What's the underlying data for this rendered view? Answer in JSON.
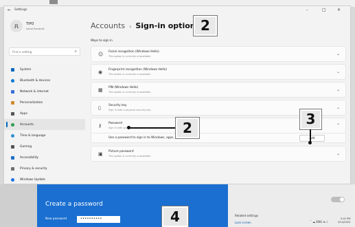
{
  "window": {
    "app_title": "Settings",
    "controls": [
      "–",
      "□",
      "✕"
    ]
  },
  "profile": {
    "initial": "ጸ",
    "name": "TIPO",
    "type": "Local Account"
  },
  "search": {
    "placeholder": "Find a setting"
  },
  "sidebar": {
    "items": [
      {
        "label": "System",
        "color": "#0067c0"
      },
      {
        "label": "Bluetooth & devices",
        "color": "#0078d4"
      },
      {
        "label": "Network & internet",
        "color": "#3a6fd8"
      },
      {
        "label": "Personalization",
        "color": "#d08a30"
      },
      {
        "label": "Apps",
        "color": "#555555"
      },
      {
        "label": "Accounts",
        "color": "#2e9c55",
        "active": true
      },
      {
        "label": "Time & language",
        "color": "#2d8fd0"
      },
      {
        "label": "Gaming",
        "color": "#555555"
      },
      {
        "label": "Accessibility",
        "color": "#1f6fc8"
      },
      {
        "label": "Privacy & security",
        "color": "#707070"
      },
      {
        "label": "Windows Update",
        "color": "#1a73e8"
      }
    ]
  },
  "main": {
    "breadcrumb_parent": "Accounts",
    "breadcrumb_sep": "›",
    "breadcrumb_current": "Sign-in options",
    "ways_label": "Ways to sign in",
    "options": [
      {
        "title": "Facial recognition (Windows Hello)",
        "subtitle": "This option is currently unavailable",
        "icon": "☺",
        "chevron": "⌄"
      },
      {
        "title": "Fingerprint recognition (Windows Hello)",
        "subtitle": "This option is currently unavailable",
        "icon": "◉",
        "chevron": "⌄"
      },
      {
        "title": "PIN (Windows Hello)",
        "subtitle": "This option is currently unavailable",
        "icon": "▦",
        "chevron": "⌄"
      },
      {
        "title": "Security key",
        "subtitle": "Sign in with a physical security key",
        "icon": "▯",
        "chevron": "⌄"
      },
      {
        "title": "Password",
        "subtitle": "Sign in with your account's password",
        "icon": "⚷",
        "chevron": "⌃"
      },
      {
        "title": "Picture password",
        "subtitle": "This option is currently unavailable",
        "icon": "▣",
        "chevron": "⌄"
      }
    ],
    "password_expand_text": "Use a password to sign in to Windows, apps, and services",
    "add_button": "Add"
  },
  "callouts": {
    "badge_2": "2",
    "badge_3": "3",
    "badge_4": "4"
  },
  "dialog": {
    "title": "Create a password",
    "new_password_label": "New password",
    "new_password_value": "••••••••••",
    "related_settings": "Related settings",
    "related_link": "Lock screen"
  },
  "taskbar": {
    "tray": "ˆ ☁ ENG ⊕ ♪",
    "time": "5:41 PM",
    "date": "3/14/2022"
  }
}
